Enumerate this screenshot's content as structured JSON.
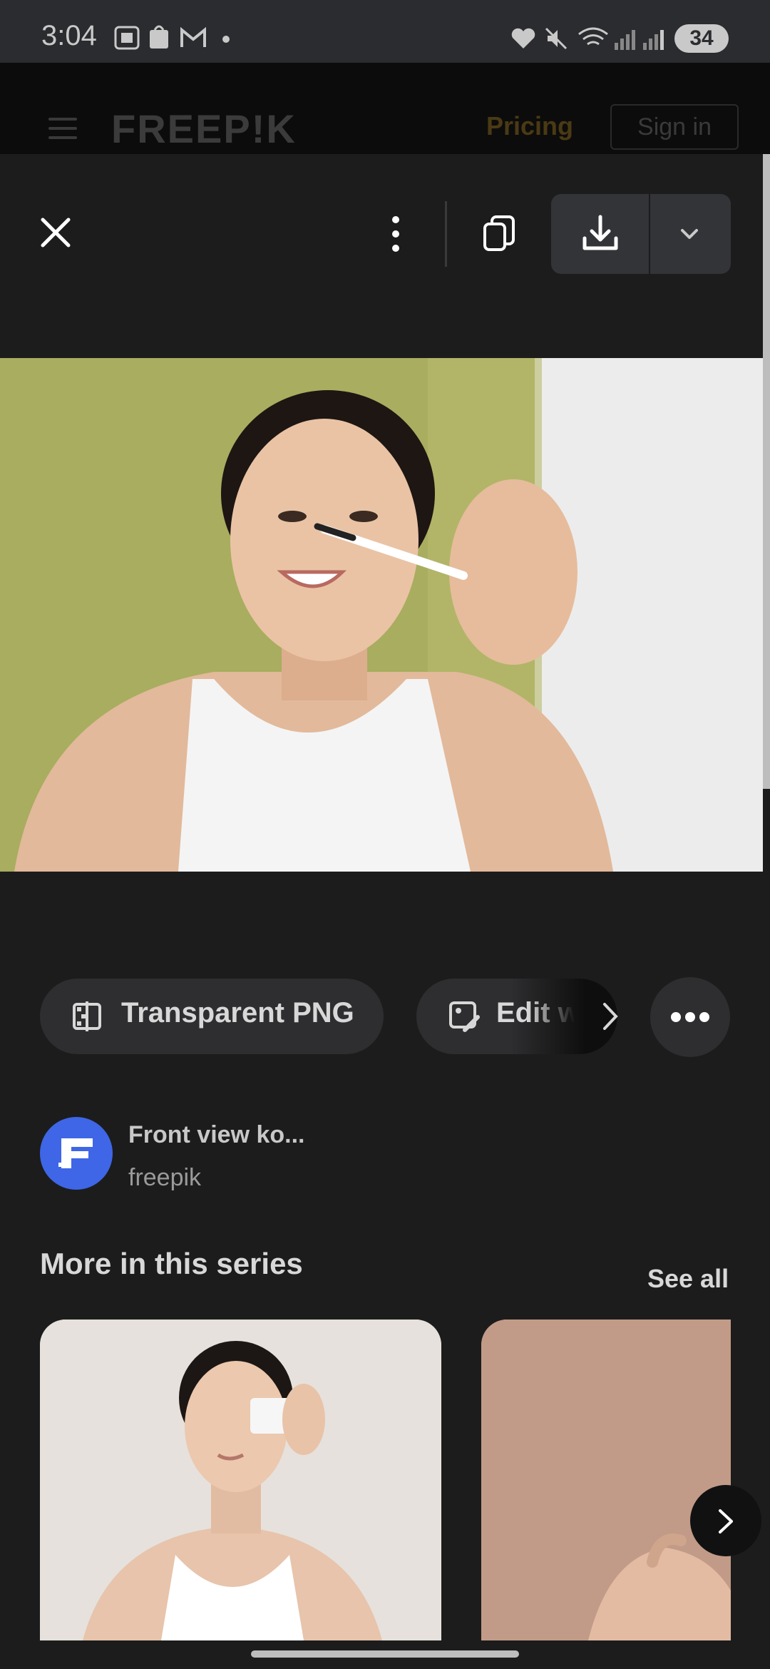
{
  "status_bar": {
    "time": "3:04",
    "battery": "34",
    "icons": [
      "screenshot-icon",
      "shop-icon",
      "gmail-icon",
      "dot-icon",
      "heart-icon",
      "mute-icon",
      "wifi-icon",
      "signal-icon",
      "signal-icon"
    ]
  },
  "site_header": {
    "logo": "FREEP!K",
    "pricing": "Pricing",
    "signin": "Sign in",
    "accent_color": "#4a3a14"
  },
  "toolbar": {
    "icons": [
      "close-icon",
      "more-vertical-icon",
      "copy-icon",
      "download-icon",
      "chevron-down-icon"
    ]
  },
  "actions": {
    "transparent_png": "Transparent PNG",
    "edit": "Edit w",
    "more_icon": "more-horizontal-icon"
  },
  "author": {
    "title": "Front view ko...",
    "name": "freepik",
    "avatar_color": "#3e66e6"
  },
  "series": {
    "title": "More in this series",
    "see_all": "See all"
  }
}
